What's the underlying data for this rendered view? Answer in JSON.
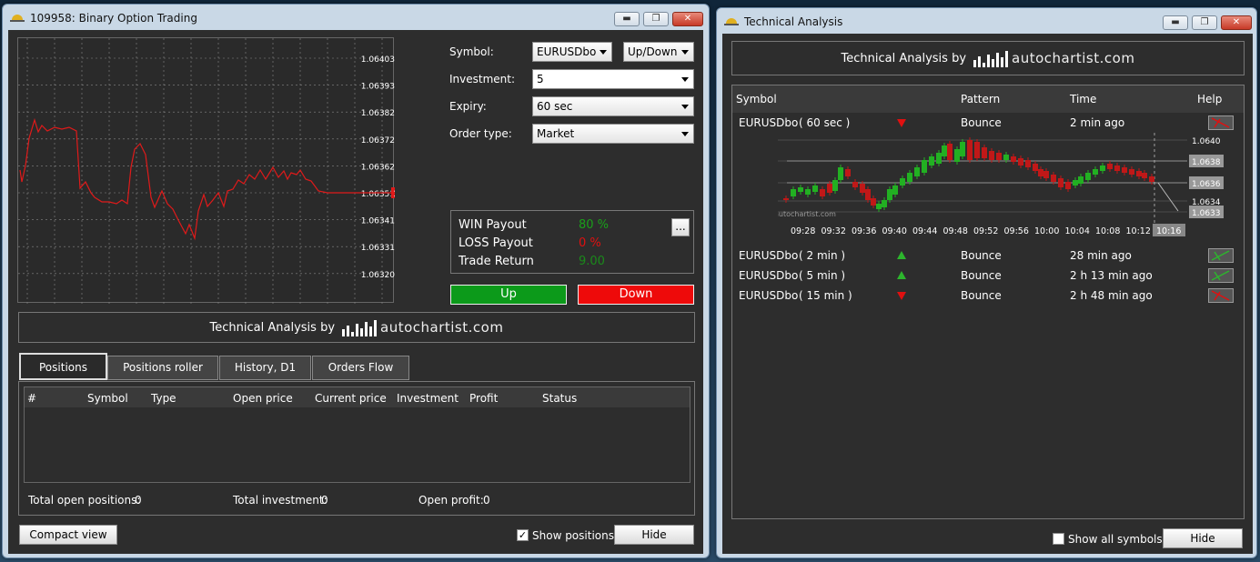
{
  "left_window": {
    "title": "109958: Binary Option Trading",
    "chart": {
      "price_labels": [
        "1.06403",
        "1.06393",
        "1.06382",
        "1.06372",
        "1.06362",
        "1.06351",
        "1.06341",
        "1.06331",
        "1.06320"
      ],
      "current_price": "1.06354",
      "line_color": "#e01a1a"
    },
    "form": {
      "symbol_label": "Symbol:",
      "symbol_value": "EURUSDbo",
      "direction_value": "Up/Down",
      "investment_label": "Investment:",
      "investment_value": "5",
      "expiry_label": "Expiry:",
      "expiry_value": "60 sec",
      "order_type_label": "Order type:",
      "order_type_value": "Market"
    },
    "payout": {
      "win_label": "WIN Payout",
      "win_value": "80 %",
      "loss_label": "LOSS Payout",
      "loss_value": "0 %",
      "return_label": "Trade Return",
      "return_value": "9.00",
      "more_button": "..."
    },
    "up_button": "Up",
    "down_button": "Down",
    "ta_banner": {
      "prefix": "Technical Analysis by",
      "brand": "autochartist.com"
    },
    "tabs": [
      "Positions",
      "Positions roller",
      "History, D1",
      "Orders Flow"
    ],
    "table_headers": [
      "#",
      "Symbol",
      "Type",
      "Open price",
      "Current price",
      "Investment",
      "Profit",
      "Status"
    ],
    "totals": {
      "open_positions_label": "Total open positions:",
      "open_positions_value": "0",
      "investment_label": "Total investment:",
      "investment_value": "0",
      "profit_label": "Open profit:",
      "profit_value": "0"
    },
    "compact_view_button": "Compact view",
    "show_positions_label": "Show positions",
    "show_positions_checked": true,
    "hide_button": "Hide"
  },
  "right_window": {
    "title": "Technical Analysis",
    "ta_banner": {
      "prefix": "Technical Analysis by",
      "brand": "autochartist.com"
    },
    "headers": [
      "Symbol",
      "Pattern",
      "Time",
      "Help"
    ],
    "rows": [
      {
        "symbol": "EURUSDbo",
        "period": "( 60 sec )",
        "direction": "down",
        "pattern": "Bounce",
        "time": "2 min ago"
      },
      {
        "symbol": "EURUSDbo",
        "period": "( 2 min )",
        "direction": "up",
        "pattern": "Bounce",
        "time": "28 min ago"
      },
      {
        "symbol": "EURUSDbo",
        "period": "( 5 min )",
        "direction": "up",
        "pattern": "Bounce",
        "time": "2 h 13 min ago"
      },
      {
        "symbol": "EURUSDbo",
        "period": "( 15 min )",
        "direction": "down",
        "pattern": "Bounce",
        "time": "2 h 48 min ago"
      }
    ],
    "mini_chart": {
      "price_labels": [
        "1.0640",
        "1.0638",
        "1.0636",
        "1.0634",
        "1.0633"
      ],
      "time_labels": [
        "09:28",
        "09:32",
        "09:36",
        "09:40",
        "09:44",
        "09:48",
        "09:52",
        "09:56",
        "10:00",
        "10:04",
        "10:08",
        "10:12",
        "10:16"
      ],
      "watermark": "autochartist.com"
    },
    "show_all_symbols_label": "Show all symbols",
    "hide_button": "Hide"
  }
}
